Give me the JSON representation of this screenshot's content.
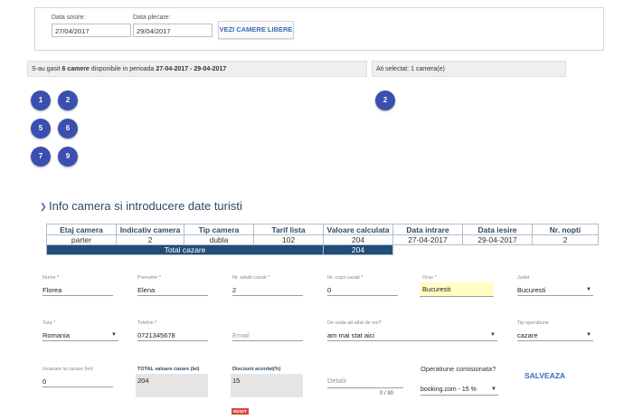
{
  "search": {
    "checkin_label": "Data sosire:",
    "checkin_value": "27/04/2017",
    "checkout_label": "Data plecare:",
    "checkout_value": "29/04/2017",
    "button_label": "VEZI CAMERE LIBERE"
  },
  "availability": {
    "prefix": "S-au gasit ",
    "count": "6 camere",
    "middle": " disponibile in perioada ",
    "period": "27-04-2017 - 29-04-2017",
    "selected": "Ati selectat: 1 camera(e)"
  },
  "rooms": [
    "1",
    "2",
    "5",
    "6",
    "7",
    "9"
  ],
  "selected_room": "2",
  "section": {
    "title": "Info camera si introducere date turisti"
  },
  "room_table": {
    "headers": [
      "Etaj camera",
      "Indicativ camera",
      "Tip camera",
      "Tarif lista",
      "Valoare calculata",
      "Data intrare",
      "Data iesire",
      "Nr. nopti"
    ],
    "row": [
      "parter",
      "2",
      "dubla",
      "102",
      "204",
      "27-04-2017",
      "29-04-2017",
      "2"
    ],
    "total_label": "Total cazare",
    "total_value": "204"
  },
  "form": {
    "nume": {
      "label": "Nume *",
      "value": "Florea"
    },
    "prenume": {
      "label": "Prenume *",
      "value": "Elena"
    },
    "adulti": {
      "label": "Nr. adulti cazati *",
      "value": "2"
    },
    "copii": {
      "label": "Nr. copii cazati *",
      "value": "0"
    },
    "oras": {
      "label": "Oras *",
      "value": "Bucuresti"
    },
    "judet": {
      "label": "Judet",
      "value": "Bucuresti"
    },
    "tara": {
      "label": "Tara *",
      "value": "Romania"
    },
    "telefon": {
      "label": "Telefon *",
      "value": "0721345678"
    },
    "email": {
      "placeholder": "Email"
    },
    "sursa": {
      "label": "De unde ati aflat de noi?",
      "value": "am mai stat aici"
    },
    "tip_operatiune": {
      "label": "Tip operatiune",
      "value": "cazare"
    },
    "incasare": {
      "label": "Incasare la cazare (lei)",
      "value": "0"
    },
    "total": {
      "label": "TOTAL valoare cazare (lei)",
      "value": "204"
    },
    "discount": {
      "label": "Discount acordat(%)",
      "value": "15"
    },
    "detalii": {
      "placeholder": "Detalii",
      "counter": "0 / 90"
    },
    "comision": {
      "label": "Operatiune comisionata?",
      "value": "booking.com - 15 %"
    },
    "save_label": "SALVEAZA",
    "reset_label": "RESET"
  }
}
